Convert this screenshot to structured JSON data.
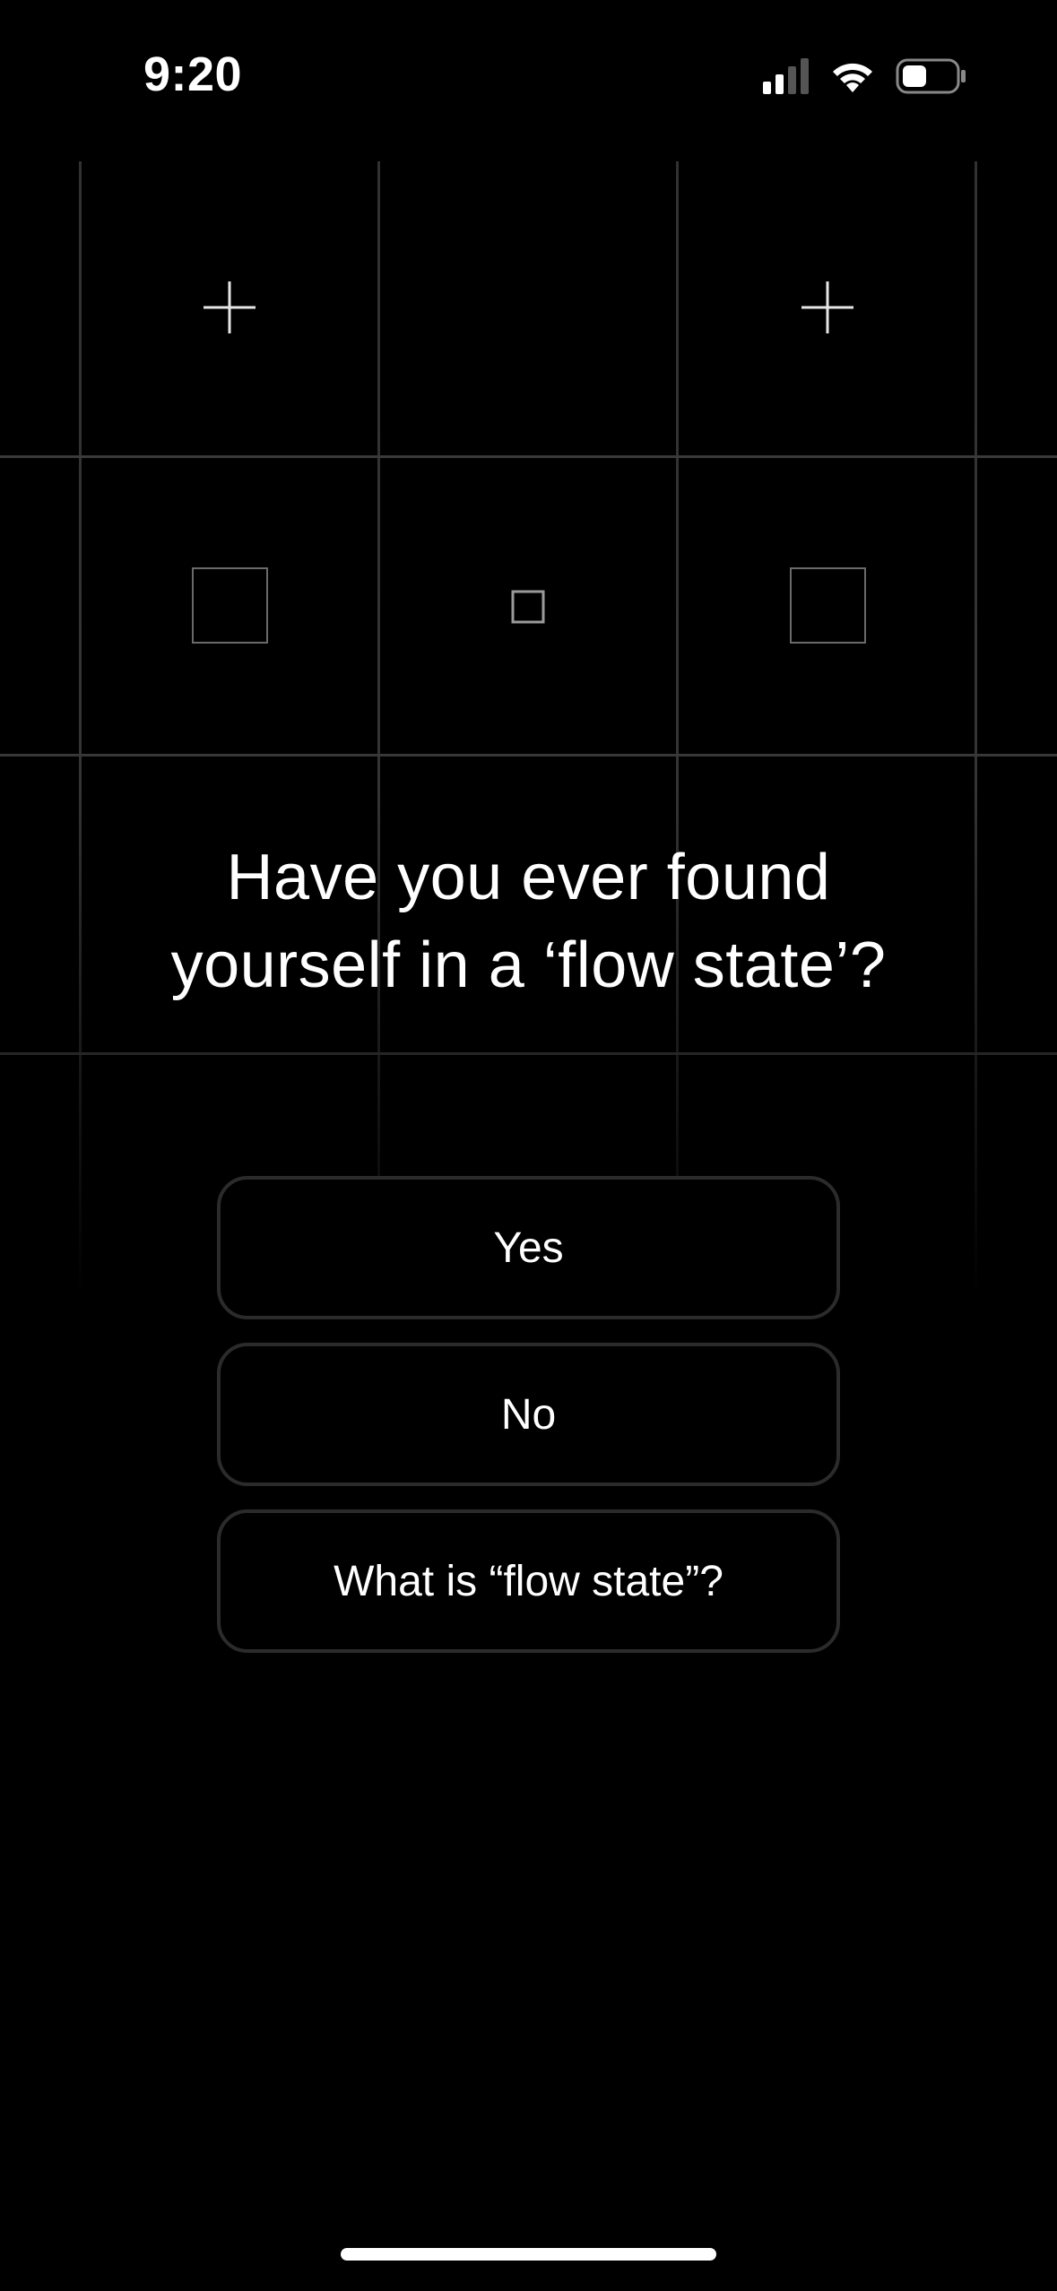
{
  "status_bar": {
    "time": "9:20",
    "icons": [
      "cellular-signal-icon",
      "wifi-icon",
      "battery-icon"
    ]
  },
  "grid": {
    "icons": [
      "plus-icon",
      "plus-icon",
      "large-square-icon",
      "small-square-icon",
      "large-square-icon"
    ]
  },
  "question": {
    "text": "Have you ever found yourself in a ‘flow state’?"
  },
  "answers": [
    {
      "label": "Yes"
    },
    {
      "label": "No"
    },
    {
      "label": "What is “flow state”?"
    }
  ],
  "colors": {
    "background": "#000000",
    "text": "#ffffff",
    "button_border": "#2b2b2b",
    "grid_line": "#3a3a3a"
  }
}
